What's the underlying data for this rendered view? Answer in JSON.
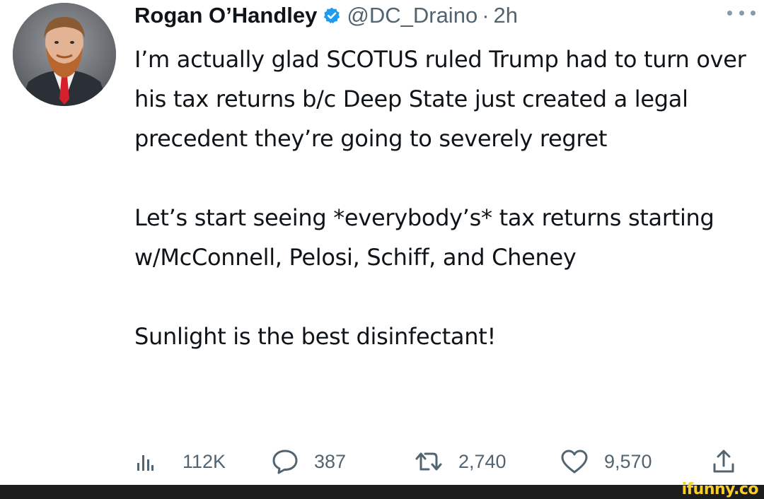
{
  "tweet": {
    "author": {
      "display_name": "Rogan O’Handley",
      "handle": "@DC_Draino",
      "separator": "·",
      "time": "2h",
      "verified": true
    },
    "text": {
      "paragraph_1": "I’m actually glad SCOTUS ruled Trump had to turn over his tax returns b/c Deep State just created a legal precedent they’re going to severely regret",
      "paragraph_2": "Let’s start seeing *everybody’s* tax returns starting w/McConnell, Pelosi, Schiff, and Cheney",
      "paragraph_3": "Sunlight is the best disinfectant!"
    },
    "metrics": {
      "views": "112K",
      "replies": "387",
      "retweets": "2,740",
      "likes": "9,570"
    },
    "icons": {
      "views": "views-bar-chart-icon",
      "replies": "reply-bubble-icon",
      "retweets": "retweet-icon",
      "likes": "heart-icon",
      "share": "share-upload-icon",
      "more": "more-dots-icon",
      "verified": "verified-badge-icon"
    },
    "colors": {
      "text": "#0f1419",
      "secondary": "#536471",
      "verified": "#1d9bf0"
    }
  },
  "watermark": {
    "brand": "ifunny.co",
    "color": "#f7ce2a"
  }
}
